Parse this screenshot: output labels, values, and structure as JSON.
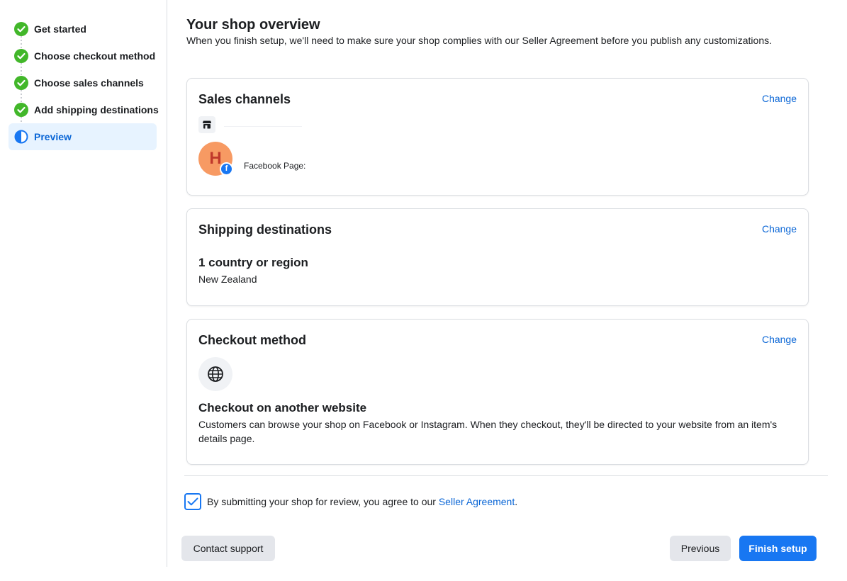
{
  "sidebar": {
    "steps": [
      {
        "label": "Get started",
        "status": "complete"
      },
      {
        "label": "Choose checkout method",
        "status": "complete"
      },
      {
        "label": "Choose sales channels",
        "status": "complete"
      },
      {
        "label": "Add shipping destinations",
        "status": "complete"
      },
      {
        "label": "Preview",
        "status": "in-progress"
      }
    ]
  },
  "header": {
    "title": "Your shop overview",
    "subtitle": "When you finish setup, we'll need to make sure your shop complies with our Seller Agreement before you publish any customizations."
  },
  "sales_channels": {
    "title": "Sales channels",
    "change_label": "Change",
    "shop_icon": "shop-icon",
    "avatar_letter": "H",
    "page_label": "Facebook Page:"
  },
  "shipping": {
    "title": "Shipping destinations",
    "change_label": "Change",
    "count_label": "1 country or region",
    "country": "New Zealand"
  },
  "checkout": {
    "title": "Checkout method",
    "change_label": "Change",
    "icon": "globe-icon",
    "method_title": "Checkout on another website",
    "description": "Customers can browse your shop on Facebook or Instagram. When they checkout, they'll be directed to your website from an item's details page."
  },
  "agreement": {
    "checked": true,
    "text": "By submitting your shop for review, you agree to our ",
    "link_text": "Seller Agreement",
    "suffix": "."
  },
  "footer": {
    "contact_label": "Contact support",
    "previous_label": "Previous",
    "finish_label": "Finish setup"
  },
  "colors": {
    "accent": "#1877f2",
    "link": "#0a66d6",
    "success": "#42b72a",
    "active_bg": "#e7f3ff"
  }
}
